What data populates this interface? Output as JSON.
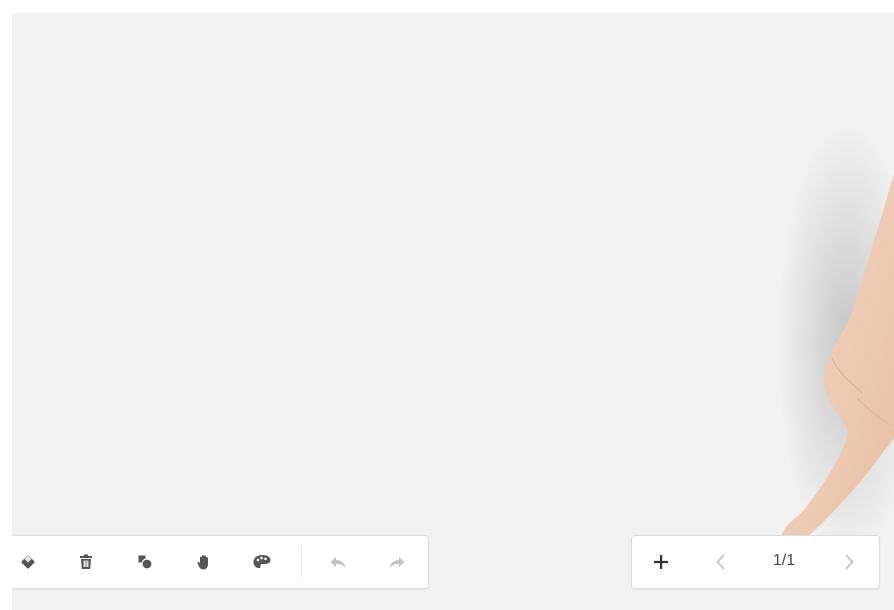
{
  "canvas": {
    "background": "#f2f2f2"
  },
  "toolbar": {
    "tools": [
      {
        "name": "eraser-icon"
      },
      {
        "name": "trash-icon"
      },
      {
        "name": "shapes-icon"
      },
      {
        "name": "hand-icon"
      },
      {
        "name": "palette-icon"
      },
      {
        "name": "undo-icon"
      },
      {
        "name": "redo-icon"
      }
    ],
    "icon_color": "#555555",
    "disabled_color": "#c4c4c4"
  },
  "pager": {
    "add_icon": "plus-icon",
    "prev_icon": "chevron-left-icon",
    "next_icon": "chevron-right-icon",
    "page_indicator": "1/1"
  }
}
